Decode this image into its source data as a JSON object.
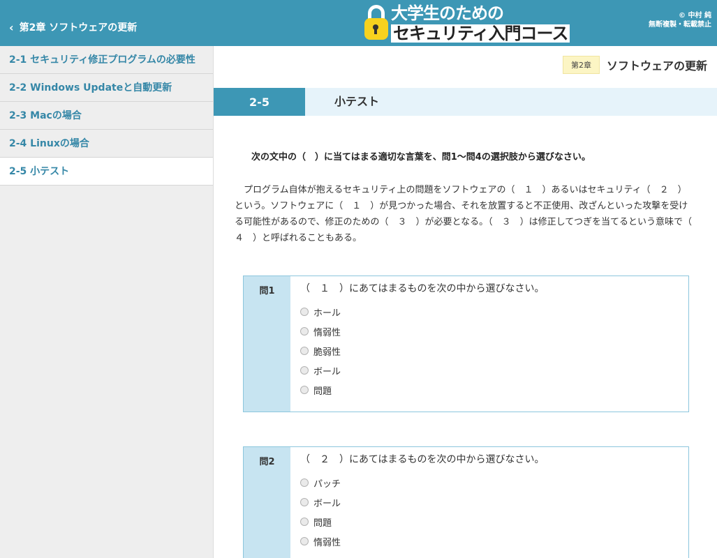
{
  "header": {
    "back_label": "第2章 ソフトウェアの更新",
    "logo_line1": "大学生のための",
    "logo_line2": "セキュリティ入門コース",
    "copyright": "© 中村 純",
    "copyright_note": "無断複製・転載禁止"
  },
  "sidebar": {
    "items": [
      {
        "label": "2-1 セキュリティ修正プログラムの必要性"
      },
      {
        "label": "2-2 Windows Updateと自動更新"
      },
      {
        "label": "2-3 Macの場合"
      },
      {
        "label": "2-4 Linuxの場合"
      },
      {
        "label": "2-5 小テスト"
      }
    ],
    "active_index": 4
  },
  "chapter": {
    "badge": "第2章",
    "title": "ソフトウェアの更新"
  },
  "section": {
    "number": "2-5",
    "title": "小テスト"
  },
  "instruction": "次の文中の（　）に当てはまる適切な言葉を、問1〜問4の選択肢から選びなさい。",
  "passage": "プログラム自体が抱えるセキュリティ上の問題をソフトウェアの（　１　）あるいはセキュリティ（　２　）という。ソフトウェアに（　１　）が見つかった場合、それを放置すると不正使用、改ざんといった攻撃を受ける可能性があるので、修正のための（　３　）が必要となる。（　３　）は修正してつぎを当てるという意味で（　４　）と呼ばれることもある。",
  "questions": [
    {
      "label": "問1",
      "text": "（　１　）にあてはまるものを次の中から選びなさい。",
      "options": [
        "ホール",
        "惰弱性",
        "脆弱性",
        "ボール",
        "問題"
      ]
    },
    {
      "label": "問2",
      "text": "（　２　）にあてはまるものを次の中から選びなさい。",
      "options": [
        "パッチ",
        "ボール",
        "問題",
        "惰弱性"
      ]
    }
  ]
}
